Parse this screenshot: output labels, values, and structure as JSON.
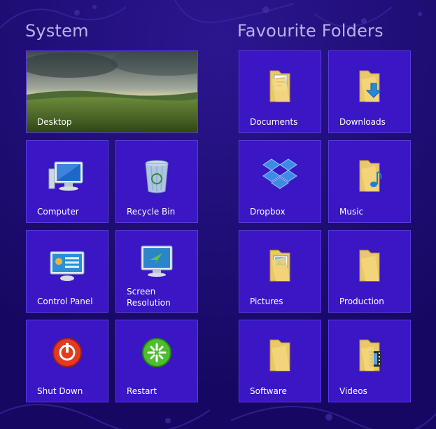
{
  "groups": {
    "system": "System",
    "favourites": "Favourite Folders"
  },
  "tiles": {
    "desktop": "Desktop",
    "computer": "Computer",
    "recycle_bin": "Recycle Bin",
    "control_panel": "Control Panel",
    "screen_resolution": "Screen Resolution",
    "shut_down": "Shut Down",
    "restart": "Restart",
    "documents": "Documents",
    "downloads": "Downloads",
    "dropbox": "Dropbox",
    "music": "Music",
    "pictures": "Pictures",
    "production": "Production",
    "software": "Software",
    "videos": "Videos"
  },
  "colors": {
    "background": "#1c0a6e",
    "tile": "#3a16c4",
    "tile_border": "#5a3be0",
    "group_title": "#b9b2e8"
  },
  "icons": {
    "desktop": "landscape-wallpaper",
    "computer": "computer-monitor-icon",
    "recycle_bin": "recycle-bin-icon",
    "control_panel": "control-panel-icon",
    "screen_resolution": "screen-resolution-icon",
    "shut_down": "power-icon",
    "restart": "restart-icon",
    "documents": "documents-folder-icon",
    "downloads": "downloads-folder-icon",
    "dropbox": "dropbox-icon",
    "music": "music-folder-icon",
    "pictures": "pictures-folder-icon",
    "production": "folder-icon",
    "software": "folder-icon",
    "videos": "videos-folder-icon"
  }
}
